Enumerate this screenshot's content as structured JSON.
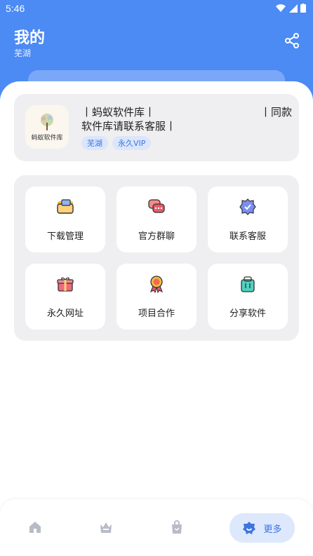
{
  "status_bar": {
    "time": "5:46"
  },
  "header": {
    "title": "我的",
    "subtitle": "芜湖"
  },
  "profile": {
    "logo_text": "蚂蚁软件库",
    "line1_left": "丨蚂蚁软件库丨",
    "line1_right": "丨同款",
    "line2": "软件库请联系客服丨",
    "tags": [
      "芜湖",
      "永久VIP"
    ]
  },
  "tiles": [
    {
      "label": "下载管理",
      "icon": "folder-icon"
    },
    {
      "label": "官方群聊",
      "icon": "chat-icon"
    },
    {
      "label": "联系客服",
      "icon": "badge-check-icon"
    },
    {
      "label": "永久网址",
      "icon": "gift-icon"
    },
    {
      "label": "项目合作",
      "icon": "medal-icon"
    },
    {
      "label": "分享软件",
      "icon": "bag-icon"
    }
  ],
  "nav": {
    "items": [
      "home-icon",
      "crown-icon",
      "shopping-bag-icon"
    ],
    "active_label": "更多",
    "active_icon": "settings-icon"
  },
  "colors": {
    "accent": "#4c8af4",
    "tag_bg": "#dbe6fb",
    "tag_text": "#3d74e0"
  }
}
